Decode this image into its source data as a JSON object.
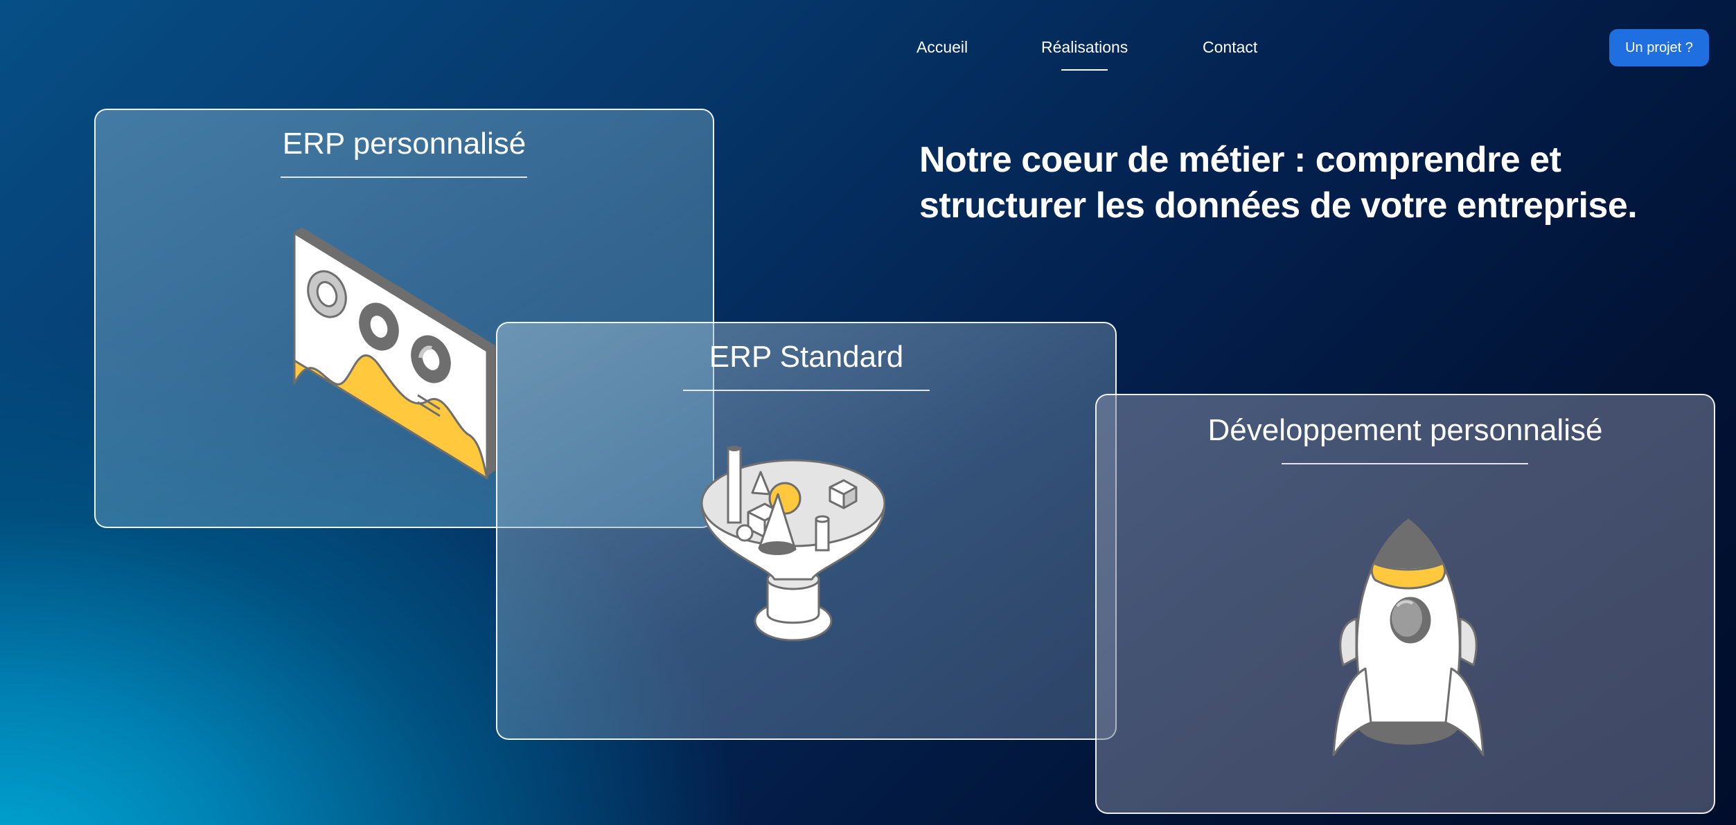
{
  "nav": {
    "items": [
      {
        "label": "Accueil",
        "active": false
      },
      {
        "label": "Réalisations",
        "active": true
      },
      {
        "label": "Contact",
        "active": false
      }
    ],
    "cta_label": "Un projet ?"
  },
  "hero": {
    "headline": "Notre coeur de métier : comprendre et structurer les données de votre entreprise."
  },
  "cards": [
    {
      "title": "ERP personnalisé",
      "icon": "dashboard-screen-icon"
    },
    {
      "title": "ERP Standard",
      "icon": "data-funnel-icon"
    },
    {
      "title": "Développement personnalisé",
      "icon": "rocket-icon"
    }
  ],
  "colors": {
    "accent_button": "#1f6fe0",
    "illustration_yellow": "#ffc83d",
    "illustration_gray": "#6e6e6e",
    "background_dark": "#010d2b",
    "background_light": "#00a7d3"
  }
}
